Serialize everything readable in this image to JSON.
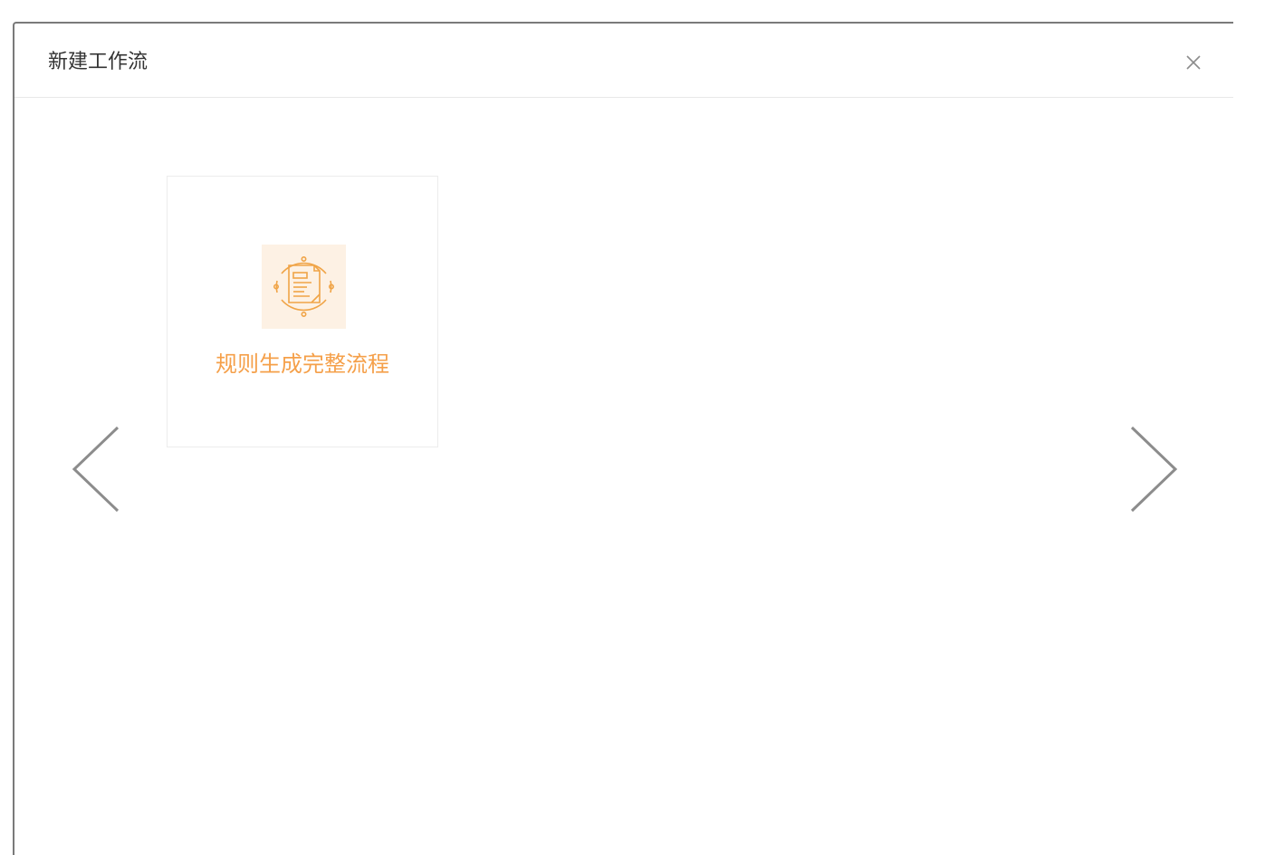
{
  "dialog": {
    "title": "新建工作流",
    "close_icon": "close-icon",
    "nav": {
      "prev_icon": "chevron-left-icon",
      "next_icon": "chevron-right-icon"
    },
    "templates": [
      {
        "label": "规则生成完整流程",
        "icon": "rule-document-icon"
      }
    ]
  },
  "colors": {
    "accent": "#f5a04a",
    "icon_bg": "#fdf1e4",
    "chevron": "#8c8c8c",
    "title": "#333333"
  }
}
